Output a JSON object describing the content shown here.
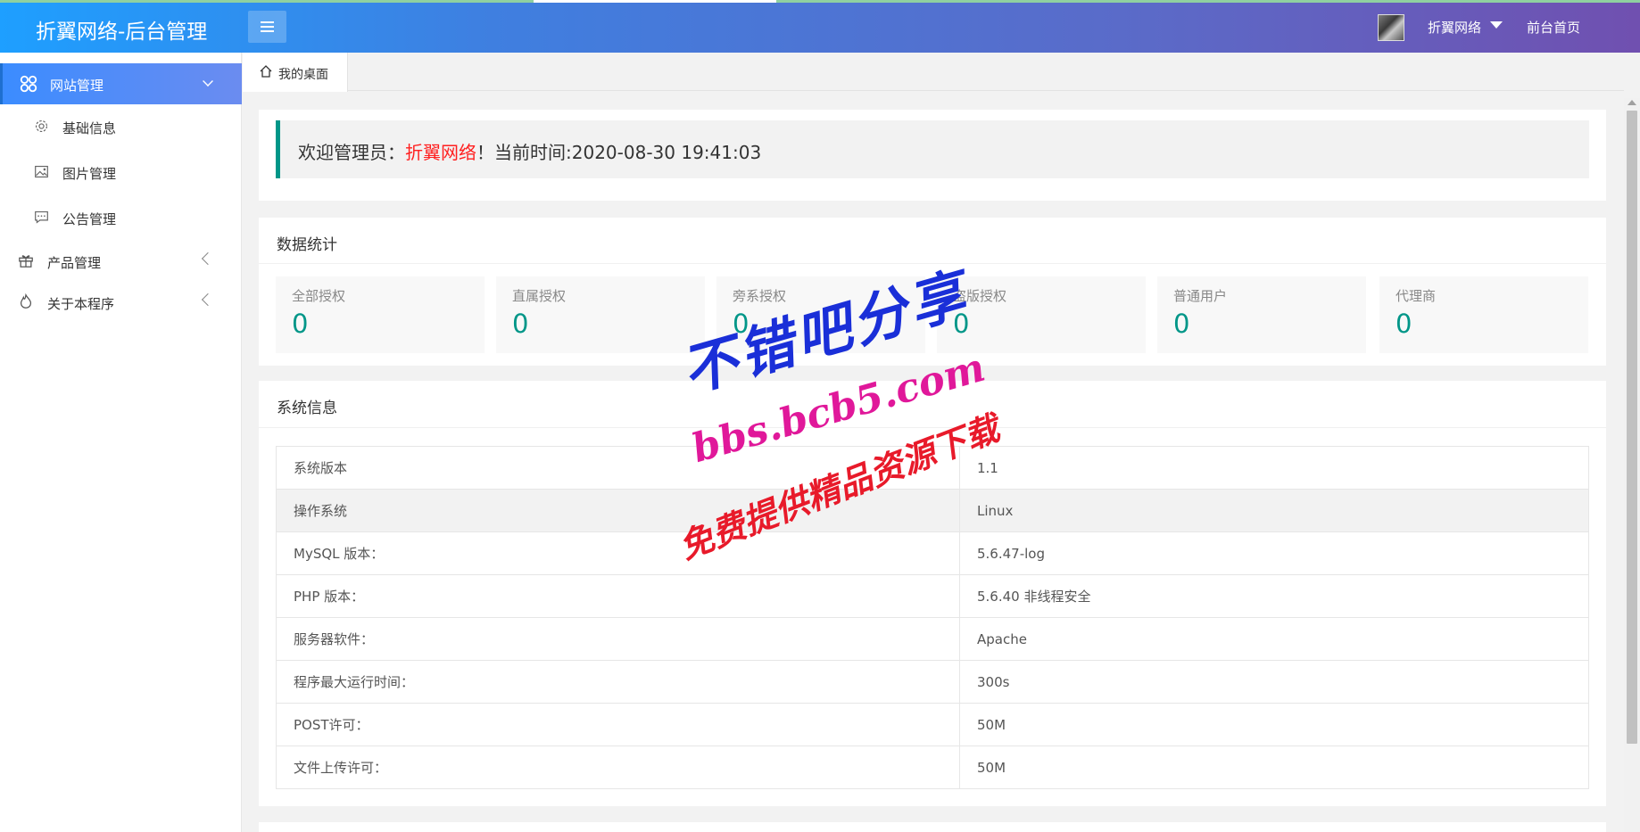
{
  "header": {
    "app_title": "折翼网络-后台管理",
    "user_name": "折翼网络",
    "front_link": "前台首页"
  },
  "sidebar": {
    "active_group": {
      "label": "网站管理",
      "icon": "flower-icon"
    },
    "sub_items": [
      {
        "label": "基础信息",
        "icon": "gear-icon"
      },
      {
        "label": "图片管理",
        "icon": "image-icon"
      },
      {
        "label": "公告管理",
        "icon": "message-icon"
      }
    ],
    "groups": [
      {
        "label": "产品管理",
        "icon": "gift-icon"
      },
      {
        "label": "关于本程序",
        "icon": "fire-icon"
      }
    ]
  },
  "tabs": [
    {
      "label": "我的桌面",
      "icon": "home-icon"
    }
  ],
  "welcome": {
    "prefix": "欢迎管理员：",
    "admin_name": "折翼网络",
    "time_label": "！当前时间:",
    "time_value": "2020-08-30 19:41:03"
  },
  "stats": {
    "title": "数据统计",
    "items": [
      {
        "name": "全部授权",
        "value": "0"
      },
      {
        "name": "直属授权",
        "value": "0"
      },
      {
        "name": "旁系授权",
        "value": "0"
      },
      {
        "name": "盗版授权",
        "value": "0"
      },
      {
        "name": "普通用户",
        "value": "0"
      },
      {
        "name": "代理商",
        "value": "0"
      }
    ]
  },
  "system": {
    "title": "系统信息",
    "rows": [
      {
        "label": "系统版本",
        "value": "1.1"
      },
      {
        "label": "操作系统",
        "value": "Linux"
      },
      {
        "label": "MySQL 版本：",
        "value": "5.6.47-log"
      },
      {
        "label": "PHP 版本：",
        "value": "5.6.40 非线程安全"
      },
      {
        "label": "服务器软件：",
        "value": "Apache"
      },
      {
        "label": "程序最大运行时间：",
        "value": "300s"
      },
      {
        "label": "POST许可：",
        "value": "50M"
      },
      {
        "label": "文件上传许可：",
        "value": "50M"
      }
    ]
  },
  "watermark": {
    "line1": "不错吧分享",
    "line2": "bbs.bcb5.com",
    "line3": "免费提供精品资源下载"
  },
  "colors": {
    "accent": "#009688",
    "highlight": "#ff2020",
    "header_start": "#1e9fff",
    "header_end": "#7050b0"
  }
}
